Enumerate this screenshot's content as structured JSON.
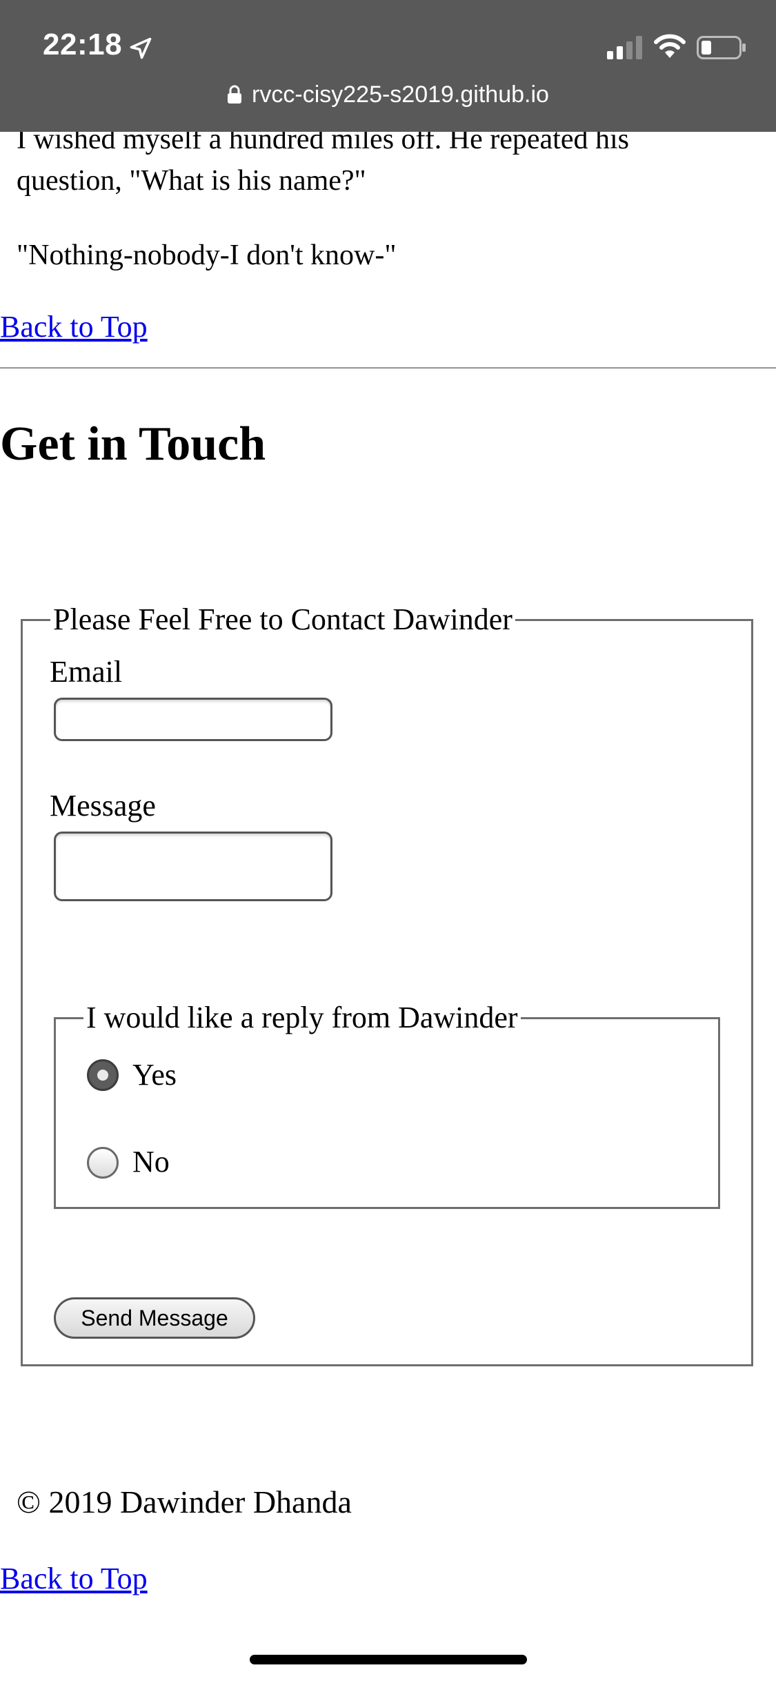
{
  "status_bar": {
    "time": "22:18",
    "url": "rvcc-cisy225-s2019.github.io",
    "icons": [
      "location-arrow-icon",
      "cellular-signal-icon",
      "wifi-icon",
      "battery-icon",
      "lock-icon"
    ]
  },
  "story": {
    "line1": "I wished myself a hundred miles off. He repeated his",
    "line2": "question, \"What is his name?\"",
    "quote": "\"Nothing-nobody-I don't know-\""
  },
  "back_to_top_label": "Back to Top",
  "contact": {
    "heading": "Get in Touch",
    "fieldset_legend": "Please Feel Free to Contact Dawinder",
    "email_label": "Email",
    "email_value": "",
    "message_label": "Message",
    "message_value": "",
    "reply_legend": "I would like a reply from Dawinder",
    "options": [
      {
        "label": "Yes",
        "selected": true
      },
      {
        "label": "No",
        "selected": false
      }
    ],
    "send_label": "Send Message"
  },
  "footer": {
    "copyright": "© 2019 Dawinder Dhanda",
    "back_to_top_label": "Back to Top"
  }
}
